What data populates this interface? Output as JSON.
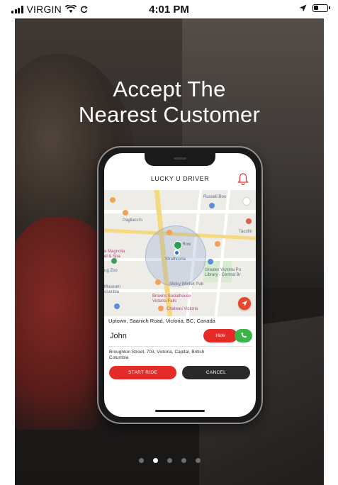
{
  "status_bar": {
    "carrier": "VIRGIN",
    "time": "4:01 PM",
    "icons": [
      "signal-icon",
      "wifi-icon",
      "sync-icon",
      "location-arrow-icon",
      "battery-icon"
    ]
  },
  "onboarding": {
    "headline_line1": "Accept The",
    "headline_line2": "Nearest Customer",
    "page_count": 5,
    "current_page": 2
  },
  "app": {
    "title": "LUCKY U DRIVER",
    "map_labels": {
      "russell": "Russell Boo",
      "pagliaccis": "Pagliacci's",
      "tacofino": "Tacofin",
      "biorow": "Bio Row",
      "strathcona": "Strathcona",
      "magnolia1": "e Magnolia",
      "magnolia2": "el & Spa",
      "zoo": "ug Zoo",
      "library1": "Greater Victoria Pu",
      "library2": "Library - Central Br",
      "sticky": "Sticky Wicket Pub",
      "museum1": "Museum",
      "museum2": "olumbia",
      "browns1": "Browns Socialhouse",
      "browns2": "Victoria Falls",
      "chateau": "Chateau Victoria"
    },
    "pickup_address": "Uptown, Saanich Road, Victoria, BC, Canada",
    "customer_name": "John",
    "hide_label": "Hide",
    "destination": "Broughton Street, 703, Victoria, Capital, British Columbia",
    "start_label": "START RIDE",
    "cancel_label": "CANCEL"
  },
  "colors": {
    "accent_red": "#e52b27",
    "call_green": "#3bb54a",
    "cancel_dark": "#2a2a2a"
  }
}
